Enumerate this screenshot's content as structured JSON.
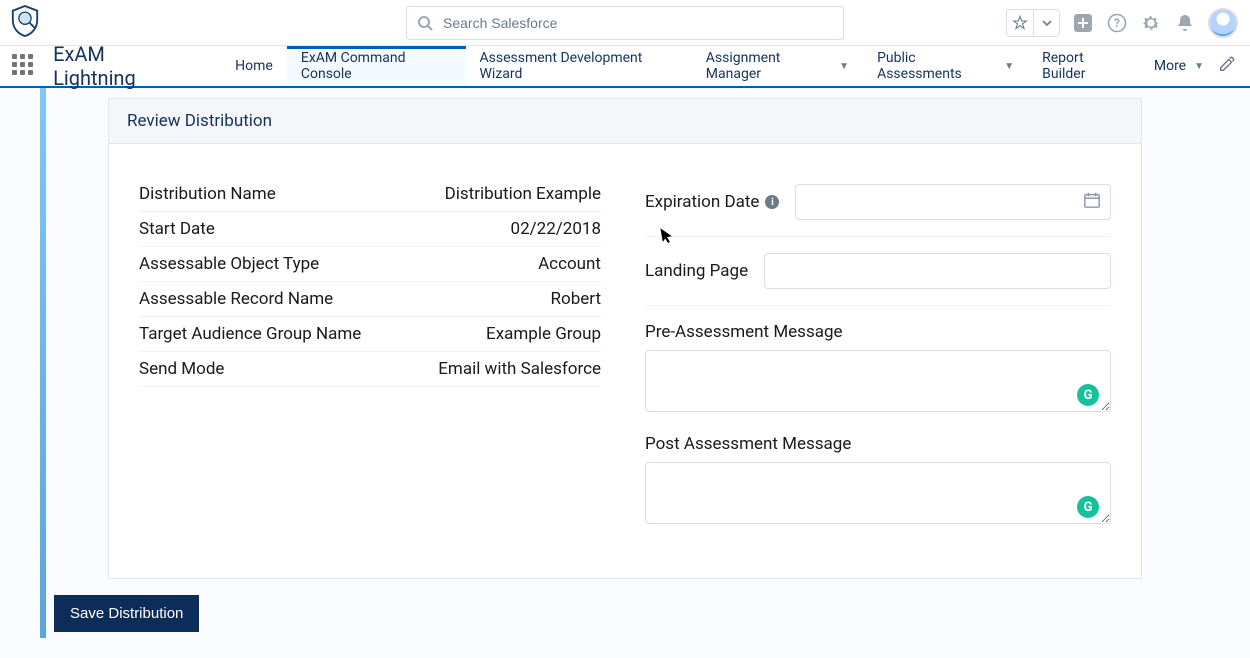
{
  "header": {
    "search_placeholder": "Search Salesforce"
  },
  "nav": {
    "app_name": "ExAM Lightning",
    "tabs": [
      {
        "label": "Home",
        "active": false,
        "has_menu": false
      },
      {
        "label": "ExAM Command Console",
        "active": true,
        "has_menu": false
      },
      {
        "label": "Assessment Development Wizard",
        "active": false,
        "has_menu": false
      },
      {
        "label": "Assignment Manager",
        "active": false,
        "has_menu": true
      },
      {
        "label": "Public Assessments",
        "active": false,
        "has_menu": true
      },
      {
        "label": "Report Builder",
        "active": false,
        "has_menu": false
      },
      {
        "label": "More",
        "active": false,
        "has_menu": true
      }
    ]
  },
  "card": {
    "title": "Review Distribution",
    "rows": [
      {
        "label": "Distribution Name",
        "value": "Distribution Example"
      },
      {
        "label": "Start Date",
        "value": "02/22/2018"
      },
      {
        "label": "Assessable Object Type",
        "value": "Account"
      },
      {
        "label": "Assessable Record Name",
        "value": "Robert"
      },
      {
        "label": "Target Audience Group Name",
        "value": "Example Group"
      },
      {
        "label": "Send Mode",
        "value": "Email with Salesforce"
      }
    ],
    "form": {
      "expiration_label": "Expiration Date",
      "expiration_value": "",
      "landing_label": "Landing Page",
      "landing_value": "",
      "pre_label": "Pre-Assessment Message",
      "pre_value": "",
      "post_label": "Post Assessment Message",
      "post_value": ""
    }
  },
  "actions": {
    "save_label": "Save Distribution"
  },
  "colors": {
    "brand_blue": "#005fb2",
    "save_btn": "#0b2d57",
    "grammarly": "#15c39a"
  }
}
